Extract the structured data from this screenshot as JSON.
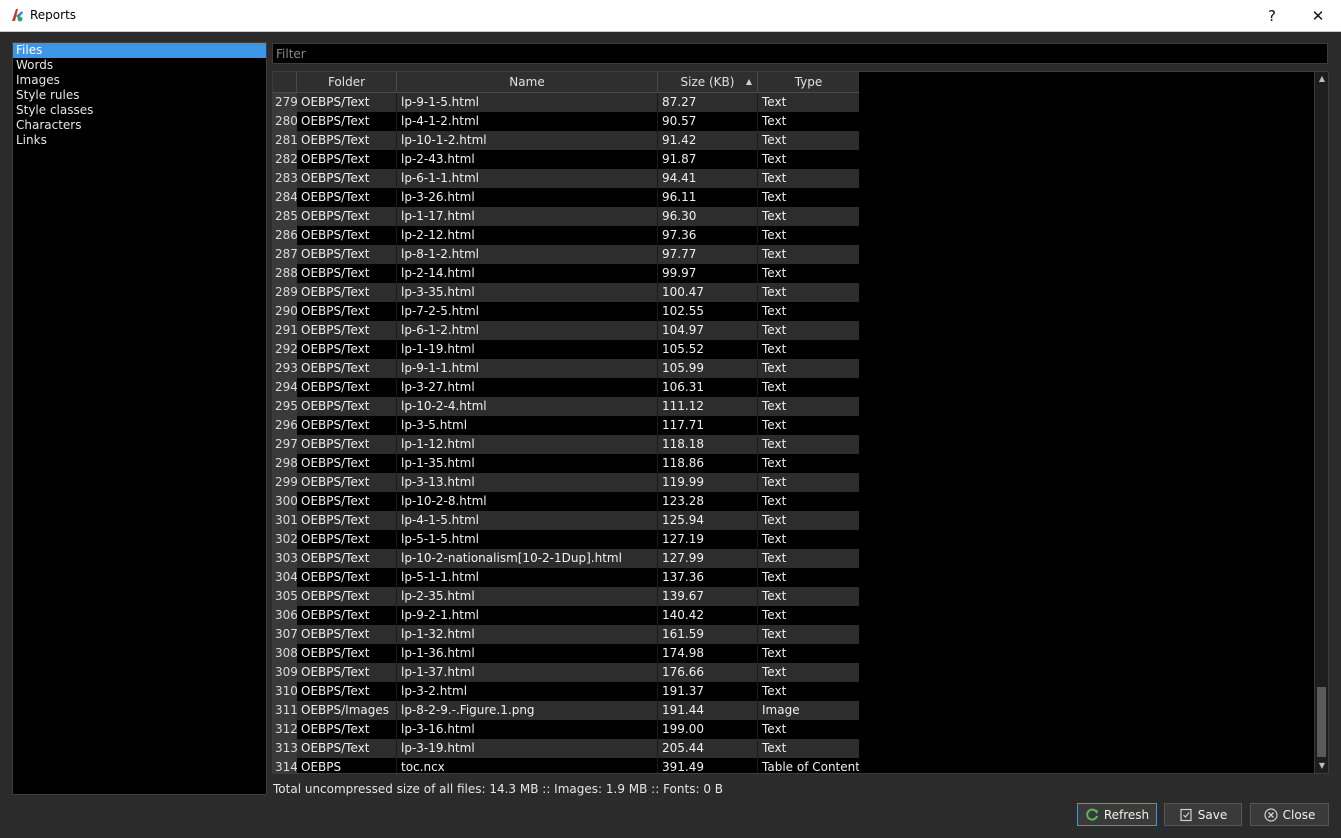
{
  "window": {
    "title": "Reports",
    "help": "?",
    "close": "✕"
  },
  "sidebar": {
    "items": [
      {
        "label": "Files",
        "selected": true
      },
      {
        "label": "Words",
        "selected": false
      },
      {
        "label": "Images",
        "selected": false
      },
      {
        "label": "Style rules",
        "selected": false
      },
      {
        "label": "Style classes",
        "selected": false
      },
      {
        "label": "Characters",
        "selected": false
      },
      {
        "label": "Links",
        "selected": false
      }
    ]
  },
  "filter": {
    "placeholder": "Filter",
    "value": ""
  },
  "table": {
    "columns": [
      "Folder",
      "Name",
      "Size (KB)",
      "Type"
    ],
    "sort_column": "Size (KB)",
    "rows": [
      [
        "279",
        "OEBPS/Text",
        "lp-9-1-5.html",
        "87.27",
        "Text"
      ],
      [
        "280",
        "OEBPS/Text",
        "lp-4-1-2.html",
        "90.57",
        "Text"
      ],
      [
        "281",
        "OEBPS/Text",
        "lp-10-1-2.html",
        "91.42",
        "Text"
      ],
      [
        "282",
        "OEBPS/Text",
        "lp-2-43.html",
        "91.87",
        "Text"
      ],
      [
        "283",
        "OEBPS/Text",
        "lp-6-1-1.html",
        "94.41",
        "Text"
      ],
      [
        "284",
        "OEBPS/Text",
        "lp-3-26.html",
        "96.11",
        "Text"
      ],
      [
        "285",
        "OEBPS/Text",
        "lp-1-17.html",
        "96.30",
        "Text"
      ],
      [
        "286",
        "OEBPS/Text",
        "lp-2-12.html",
        "97.36",
        "Text"
      ],
      [
        "287",
        "OEBPS/Text",
        "lp-8-1-2.html",
        "97.77",
        "Text"
      ],
      [
        "288",
        "OEBPS/Text",
        "lp-2-14.html",
        "99.97",
        "Text"
      ],
      [
        "289",
        "OEBPS/Text",
        "lp-3-35.html",
        "100.47",
        "Text"
      ],
      [
        "290",
        "OEBPS/Text",
        "lp-7-2-5.html",
        "102.55",
        "Text"
      ],
      [
        "291",
        "OEBPS/Text",
        "lp-6-1-2.html",
        "104.97",
        "Text"
      ],
      [
        "292",
        "OEBPS/Text",
        "lp-1-19.html",
        "105.52",
        "Text"
      ],
      [
        "293",
        "OEBPS/Text",
        "lp-9-1-1.html",
        "105.99",
        "Text"
      ],
      [
        "294",
        "OEBPS/Text",
        "lp-3-27.html",
        "106.31",
        "Text"
      ],
      [
        "295",
        "OEBPS/Text",
        "lp-10-2-4.html",
        "111.12",
        "Text"
      ],
      [
        "296",
        "OEBPS/Text",
        "lp-3-5.html",
        "117.71",
        "Text"
      ],
      [
        "297",
        "OEBPS/Text",
        "lp-1-12.html",
        "118.18",
        "Text"
      ],
      [
        "298",
        "OEBPS/Text",
        "lp-1-35.html",
        "118.86",
        "Text"
      ],
      [
        "299",
        "OEBPS/Text",
        "lp-3-13.html",
        "119.99",
        "Text"
      ],
      [
        "300",
        "OEBPS/Text",
        "lp-10-2-8.html",
        "123.28",
        "Text"
      ],
      [
        "301",
        "OEBPS/Text",
        "lp-4-1-5.html",
        "125.94",
        "Text"
      ],
      [
        "302",
        "OEBPS/Text",
        "lp-5-1-5.html",
        "127.19",
        "Text"
      ],
      [
        "303",
        "OEBPS/Text",
        "lp-10-2-nationalism[10-2-1Dup].html",
        "127.99",
        "Text"
      ],
      [
        "304",
        "OEBPS/Text",
        "lp-5-1-1.html",
        "137.36",
        "Text"
      ],
      [
        "305",
        "OEBPS/Text",
        "lp-2-35.html",
        "139.67",
        "Text"
      ],
      [
        "306",
        "OEBPS/Text",
        "lp-9-2-1.html",
        "140.42",
        "Text"
      ],
      [
        "307",
        "OEBPS/Text",
        "lp-1-32.html",
        "161.59",
        "Text"
      ],
      [
        "308",
        "OEBPS/Text",
        "lp-1-36.html",
        "174.98",
        "Text"
      ],
      [
        "309",
        "OEBPS/Text",
        "lp-1-37.html",
        "176.66",
        "Text"
      ],
      [
        "310",
        "OEBPS/Text",
        "lp-3-2.html",
        "191.37",
        "Text"
      ],
      [
        "311",
        "OEBPS/Images",
        "lp-8-2-9.-.Figure.1.png",
        "191.44",
        "Image"
      ],
      [
        "312",
        "OEBPS/Text",
        "lp-3-16.html",
        "199.00",
        "Text"
      ],
      [
        "313",
        "OEBPS/Text",
        "lp-3-19.html",
        "205.44",
        "Text"
      ],
      [
        "314",
        "OEBPS",
        "toc.ncx",
        "391.49",
        "Table of Contents"
      ]
    ]
  },
  "status": {
    "text": "Total uncompressed size of all files: 14.3 MB :: Images: 1.9 MB :: Fonts: 0 B"
  },
  "buttons": {
    "refresh": "Refresh",
    "save": "Save",
    "close": "Close"
  },
  "colors": {
    "accent": "#3d95e6",
    "background": "#2b2b2b",
    "row_alt": "#2d2d2d"
  }
}
